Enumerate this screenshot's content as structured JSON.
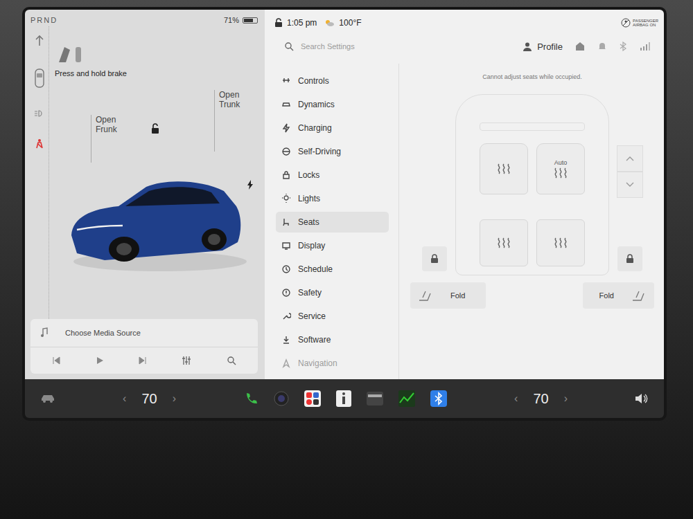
{
  "status": {
    "gear": "PRND",
    "battery": "71%",
    "battery_level": 0.71,
    "locked": false,
    "time": "1:05 pm",
    "temperature": "100°F",
    "airbag": [
      "PASSENGER",
      "AIRBAG ON"
    ]
  },
  "car": {
    "brake_hint": "Press and hold brake",
    "frunk": "Open Frunk",
    "trunk": "Open Trunk"
  },
  "media": {
    "title": "Choose Media Source"
  },
  "search": {
    "placeholder": "Search Settings"
  },
  "profile": {
    "label": "Profile"
  },
  "menu": [
    {
      "label": "Controls",
      "selected": false
    },
    {
      "label": "Dynamics",
      "selected": false
    },
    {
      "label": "Charging",
      "selected": false
    },
    {
      "label": "Self-Driving",
      "selected": false
    },
    {
      "label": "Locks",
      "selected": false
    },
    {
      "label": "Lights",
      "selected": false
    },
    {
      "label": "Seats",
      "selected": true
    },
    {
      "label": "Display",
      "selected": false
    },
    {
      "label": "Schedule",
      "selected": false
    },
    {
      "label": "Safety",
      "selected": false
    },
    {
      "label": "Service",
      "selected": false
    },
    {
      "label": "Software",
      "selected": false
    },
    {
      "label": "Navigation",
      "selected": false
    }
  ],
  "seats": {
    "notice": "Cannot adjust seats while occupied.",
    "auto_label": "Auto",
    "heaters": [
      {
        "auto": false
      },
      {
        "auto": true
      },
      {
        "auto": false
      },
      {
        "auto": false
      }
    ],
    "fold_buttons": [
      "Fold",
      "Fold"
    ]
  },
  "climate": {
    "driver": "70",
    "passenger": "70",
    "decrease": "‹",
    "increase": "›"
  }
}
